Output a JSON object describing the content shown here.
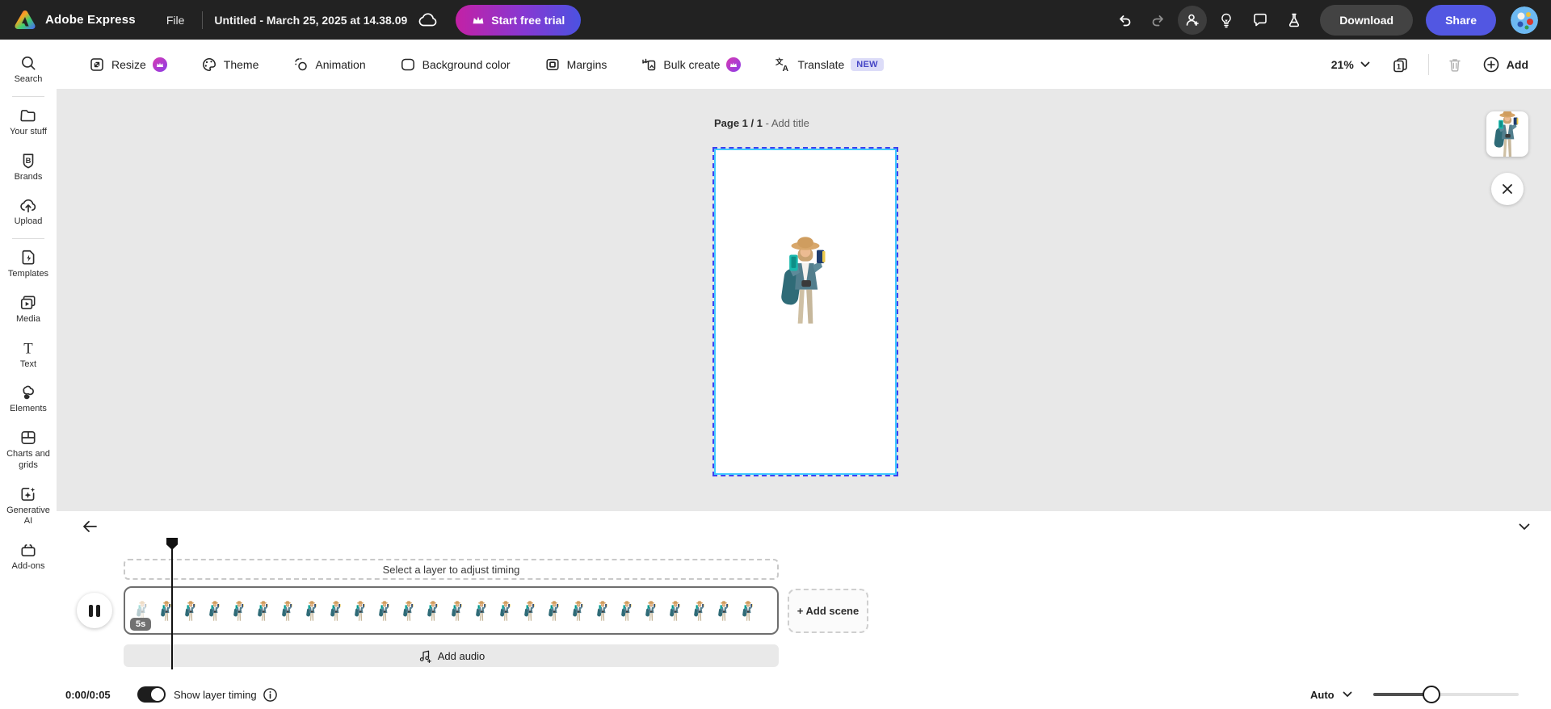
{
  "topbar": {
    "app_name": "Adobe Express",
    "file_menu": "File",
    "document_title": "Untitled - March 25, 2025 at 14.38.09",
    "start_trial_label": "Start free trial",
    "download_label": "Download",
    "share_label": "Share"
  },
  "toolbar": {
    "items": [
      {
        "label": "Resize",
        "premium": true
      },
      {
        "label": "Theme",
        "premium": false
      },
      {
        "label": "Animation",
        "premium": false
      },
      {
        "label": "Background color",
        "premium": false
      },
      {
        "label": "Margins",
        "premium": false
      },
      {
        "label": "Bulk create",
        "premium": true
      },
      {
        "label": "Translate",
        "badge": "NEW"
      }
    ],
    "zoom_level": "21%",
    "page_count_glyph": "1",
    "add_label": "Add"
  },
  "sidebar": {
    "items": [
      {
        "label": "Search"
      },
      {
        "label": "Your stuff"
      },
      {
        "label": "Brands"
      },
      {
        "label": "Upload"
      },
      {
        "label": "Templates"
      },
      {
        "label": "Media"
      },
      {
        "label": "Text"
      },
      {
        "label": "Elements"
      },
      {
        "label": "Charts and grids"
      },
      {
        "label": "Generative AI"
      },
      {
        "label": "Add-ons"
      }
    ]
  },
  "canvas": {
    "page_label": "Page 1 / 1",
    "page_title_suffix": "- Add title"
  },
  "timeline": {
    "select_layer_hint": "Select a layer to adjust timing",
    "scene_duration": "5s",
    "add_scene_label": "+ Add scene",
    "add_audio_label": "Add audio",
    "time_display": "0:00/0:05",
    "show_layer_timing_label": "Show layer timing",
    "show_layer_timing_on": true,
    "speed_label": "Auto",
    "thumbnail_count": 26,
    "slider_percent": 40
  },
  "colors": {
    "topbar_bg": "#222222",
    "accent_indigo": "#5257e2",
    "trial_gradient_start": "#c321a5",
    "trial_gradient_end": "#4b52e1",
    "selection_dashed_blue": "#3f3fef",
    "selection_cyan": "#41c9ff",
    "workspace_bg": "#e8e8e8"
  }
}
